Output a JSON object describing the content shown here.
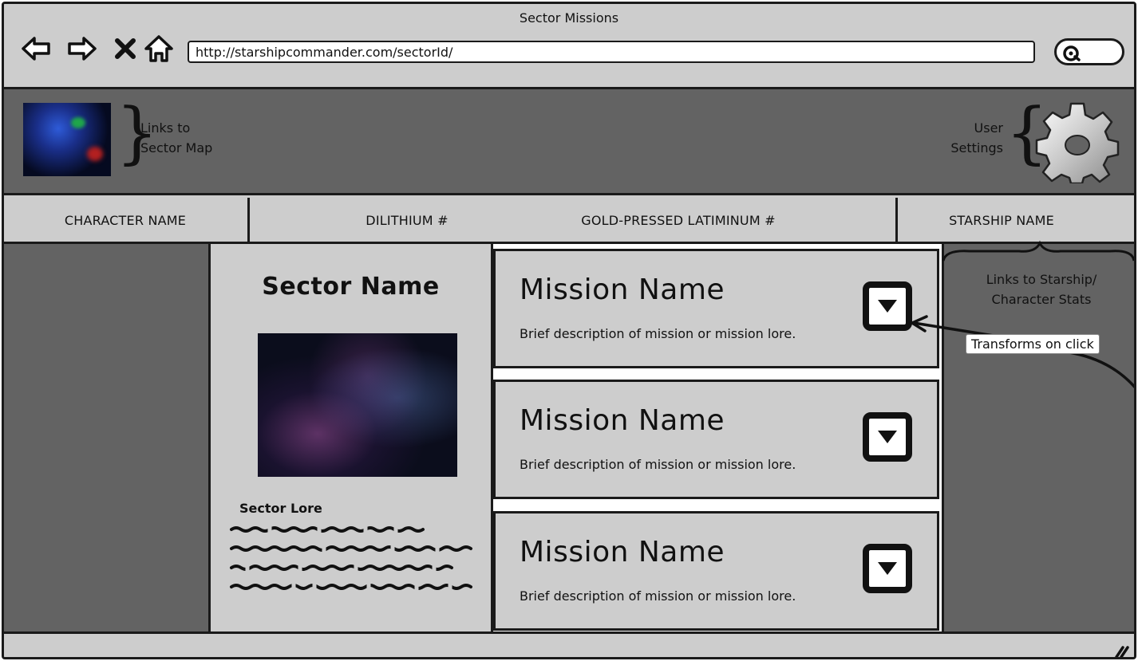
{
  "window": {
    "title": "Sector Missions"
  },
  "browser": {
    "url": "http://starshipcommander.com/sectorId/",
    "nav_icons": [
      "back-arrow-icon",
      "forward-arrow-icon",
      "close-icon",
      "home-icon",
      "search-icon"
    ]
  },
  "header": {
    "map_note": "Links to\nSector Map",
    "settings_note": "User\nSettings",
    "icons": [
      "sector-map-image",
      "gear-icon"
    ]
  },
  "stats": {
    "character_name": "CHARACTER NAME",
    "dilithium": "DILITHIUM #",
    "latinum": "GOLD-PRESSED LATIMINUM #",
    "starship_name": "STARSHIP NAME"
  },
  "sector": {
    "title": "Sector Name",
    "lore_title": "Sector Lore"
  },
  "missions": [
    {
      "name": "Mission Name",
      "description": "Brief description of mission or mission lore."
    },
    {
      "name": "Mission Name",
      "description": "Brief description of mission or mission lore."
    },
    {
      "name": "Mission Name",
      "description": "Brief description of mission or mission lore."
    }
  ],
  "annotations": {
    "stats_note": "Links to Starship/\nCharacter Stats",
    "transform_note": "Transforms on click"
  },
  "colors": {
    "chrome": "#cdcdcd",
    "dark_panel": "#636363",
    "border": "#1a1a1a"
  }
}
